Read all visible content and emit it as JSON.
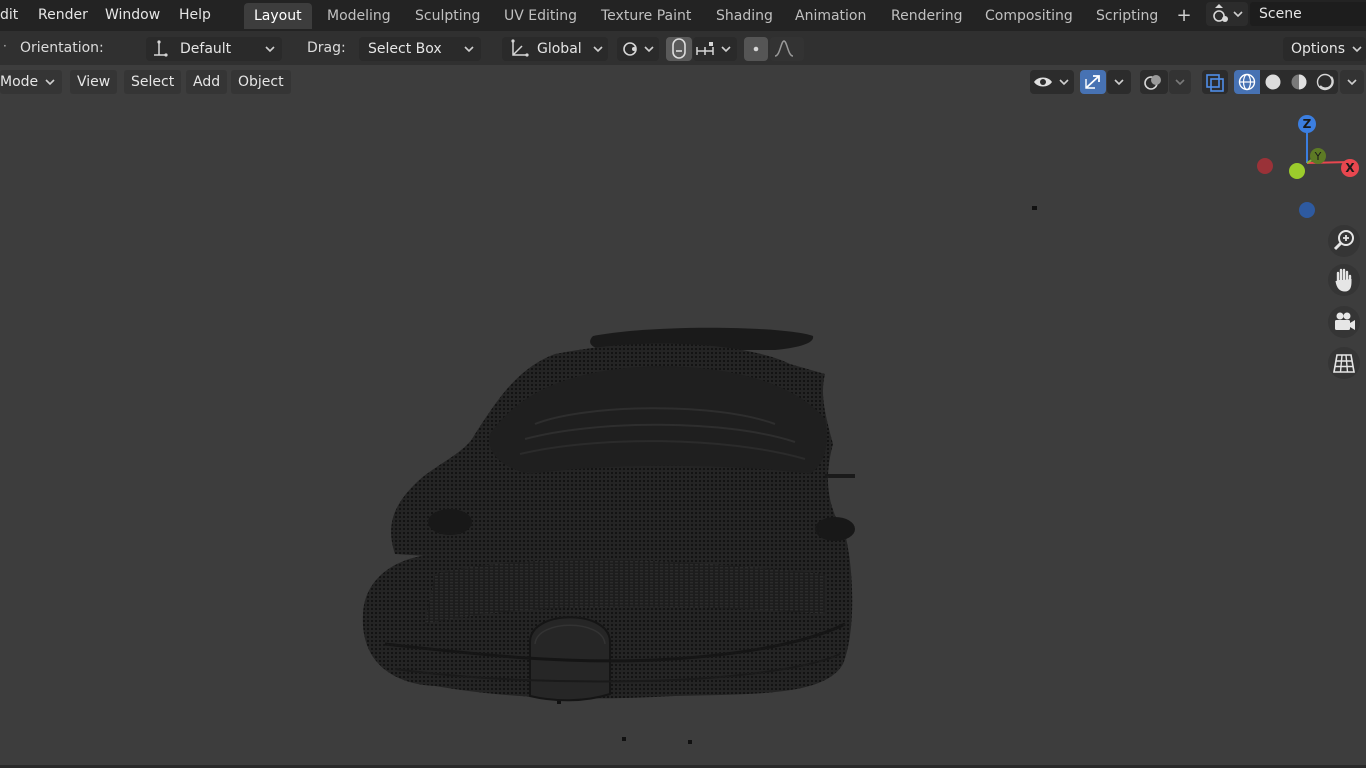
{
  "topbar": {
    "menus": [
      "dit",
      "Render",
      "Window",
      "Help"
    ],
    "workspaces": [
      {
        "label": "Layout",
        "active": true
      },
      {
        "label": "Modeling",
        "active": false
      },
      {
        "label": "Sculpting",
        "active": false
      },
      {
        "label": "UV Editing",
        "active": false
      },
      {
        "label": "Texture Paint",
        "active": false
      },
      {
        "label": "Shading",
        "active": false
      },
      {
        "label": "Animation",
        "active": false
      },
      {
        "label": "Rendering",
        "active": false
      },
      {
        "label": "Compositing",
        "active": false
      },
      {
        "label": "Scripting",
        "active": false
      }
    ],
    "add_tab": "+",
    "scene_name": "Scene"
  },
  "toolbar": {
    "orientation_label": "Orientation:",
    "orientation_value": "Default",
    "drag_label": "Drag:",
    "drag_value": "Select Box",
    "transform_orientation": "Global",
    "options_label": "Options"
  },
  "viewport_header": {
    "mode": "Mode",
    "menus": [
      "View",
      "Select",
      "Add",
      "Object"
    ]
  },
  "gizmo": {
    "z_label": "Z",
    "x_label": "X",
    "y_label": "Y",
    "colors": {
      "x": "#e8474f",
      "y": "#8bb338",
      "z": "#3b7ee0"
    }
  },
  "icons": {
    "pivot": "pivot-icon",
    "transform_orientation": "axes-icon",
    "snapping": "magnet-icon",
    "proportional": "proportional-falloff-icon",
    "view_zoom": "zoom-icon",
    "view_pan": "hand-icon",
    "view_camera": "camera-icon",
    "view_ortho": "grid-icon"
  }
}
